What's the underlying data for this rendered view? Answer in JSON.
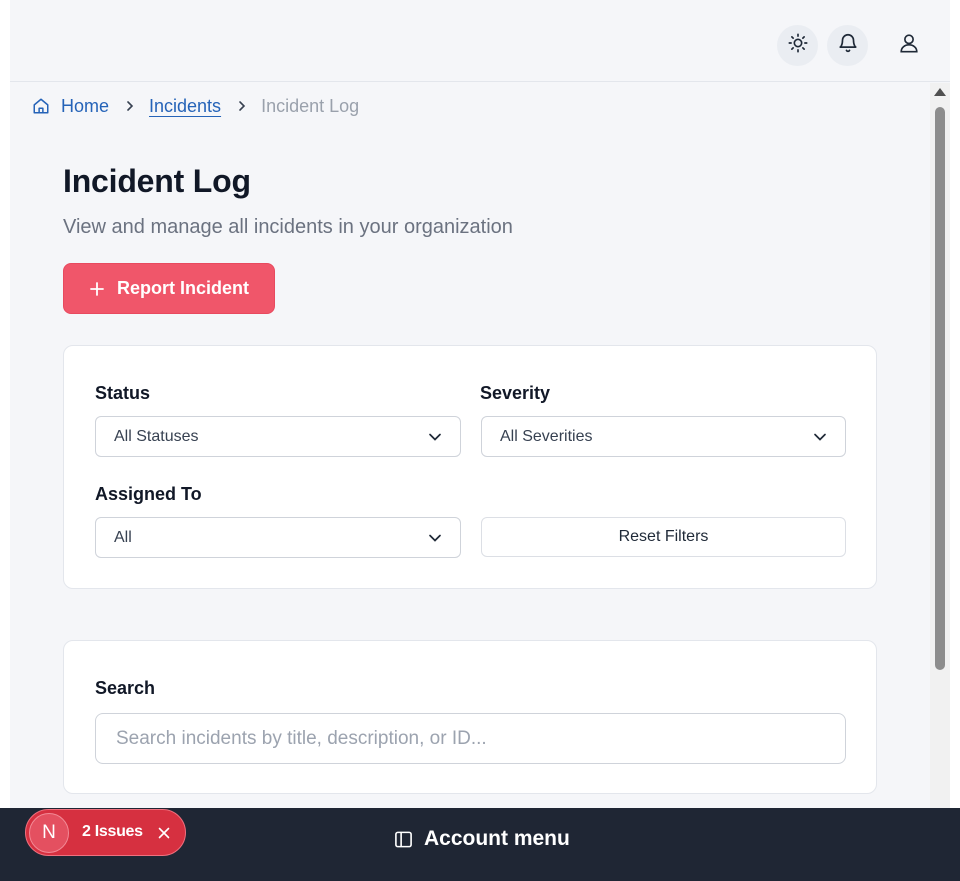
{
  "header": {
    "theme_icon": "sun-icon",
    "notifications_icon": "bell-icon",
    "user_icon": "user-icon"
  },
  "breadcrumb": {
    "home": "Home",
    "incidents": "Incidents",
    "current": "Incident Log"
  },
  "page": {
    "title": "Incident Log",
    "subtitle": "View and manage all incidents in your organization",
    "report_button": "Report Incident"
  },
  "filters": {
    "status_label": "Status",
    "status_value": "All Statuses",
    "severity_label": "Severity",
    "severity_value": "All Severities",
    "assigned_label": "Assigned To",
    "assigned_value": "All",
    "reset_button": "Reset Filters"
  },
  "search": {
    "label": "Search",
    "placeholder": "Search incidents by title, description, or ID..."
  },
  "footer": {
    "account_menu": "Account menu",
    "issues_logo": "N",
    "issues_label": "2 Issues"
  },
  "colors": {
    "accent": "#f0566a",
    "link": "#2563b8",
    "footer_bg": "#1f2634",
    "issues_badge": "#d63040"
  }
}
